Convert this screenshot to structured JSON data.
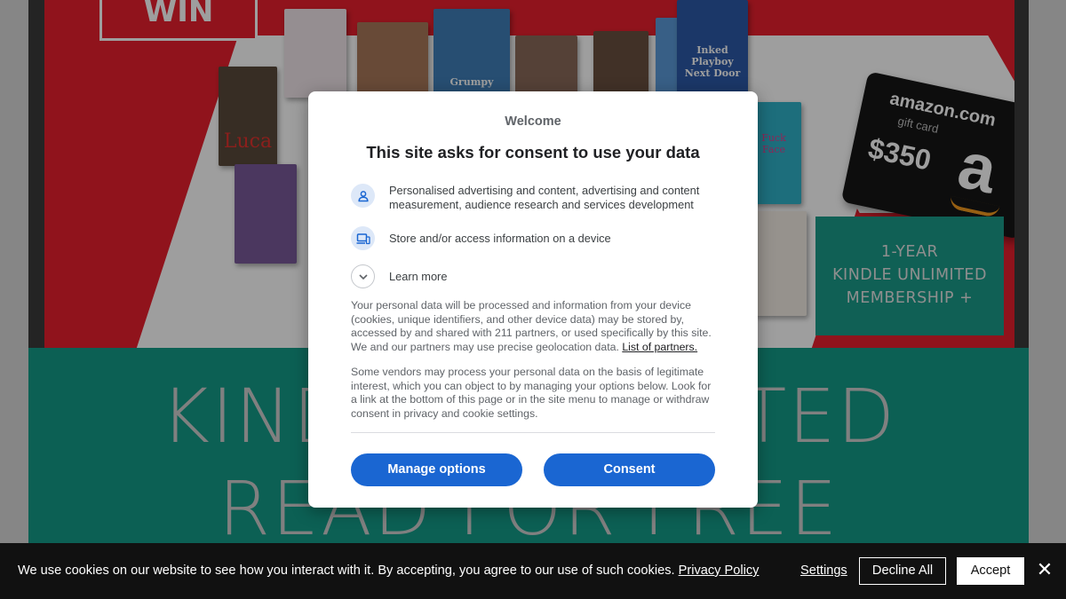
{
  "background": {
    "win_badge": "WIN",
    "books": [
      "Luca",
      "Grumpy",
      "Inked Playboy Next Door",
      "Fuck Face"
    ],
    "amazon_card": {
      "brand": "amazon.com",
      "subtitle": "gift card",
      "amount": "$350",
      "logo_letter": "a"
    },
    "promo_lines": [
      "1-YEAR",
      "KINDLE UNLIMITED",
      "MEMBERSHIP +"
    ],
    "banner_line1": "KINDLE UNLIMITED",
    "banner_line2": "READ FOR FREE"
  },
  "consent_dialog": {
    "welcome": "Welcome",
    "title": "This site asks for consent to use your data",
    "purposes": [
      {
        "icon": "person-icon",
        "text": "Personalised advertising and content, advertising and content measurement, audience research and services development"
      },
      {
        "icon": "device-icon",
        "text": "Store and/or access information on a device"
      }
    ],
    "learn_more": "Learn more",
    "paragraph1": "Your personal data will be processed and information from your device (cookies, unique identifiers, and other device data) may be stored by, accessed by and shared with 211 partners, or used specifically by this site. We and our partners may use precise geolocation data.",
    "partners_link": "List of partners.",
    "paragraph2": "Some vendors may process your personal data on the basis of legitimate interest, which you can object to by managing your options below. Look for a link at the bottom of this page or in the site menu to manage or withdraw consent in privacy and cookie settings.",
    "manage_options": "Manage options",
    "consent": "Consent",
    "accent_color": "#1a66d2"
  },
  "cookie_bar": {
    "text": "We use cookies on our website to see how you interact with it. By accepting, you agree to our use of such cookies.",
    "privacy_link": "Privacy Policy",
    "settings": "Settings",
    "decline_all": "Decline All",
    "accept": "Accept",
    "close_icon": "✕"
  }
}
